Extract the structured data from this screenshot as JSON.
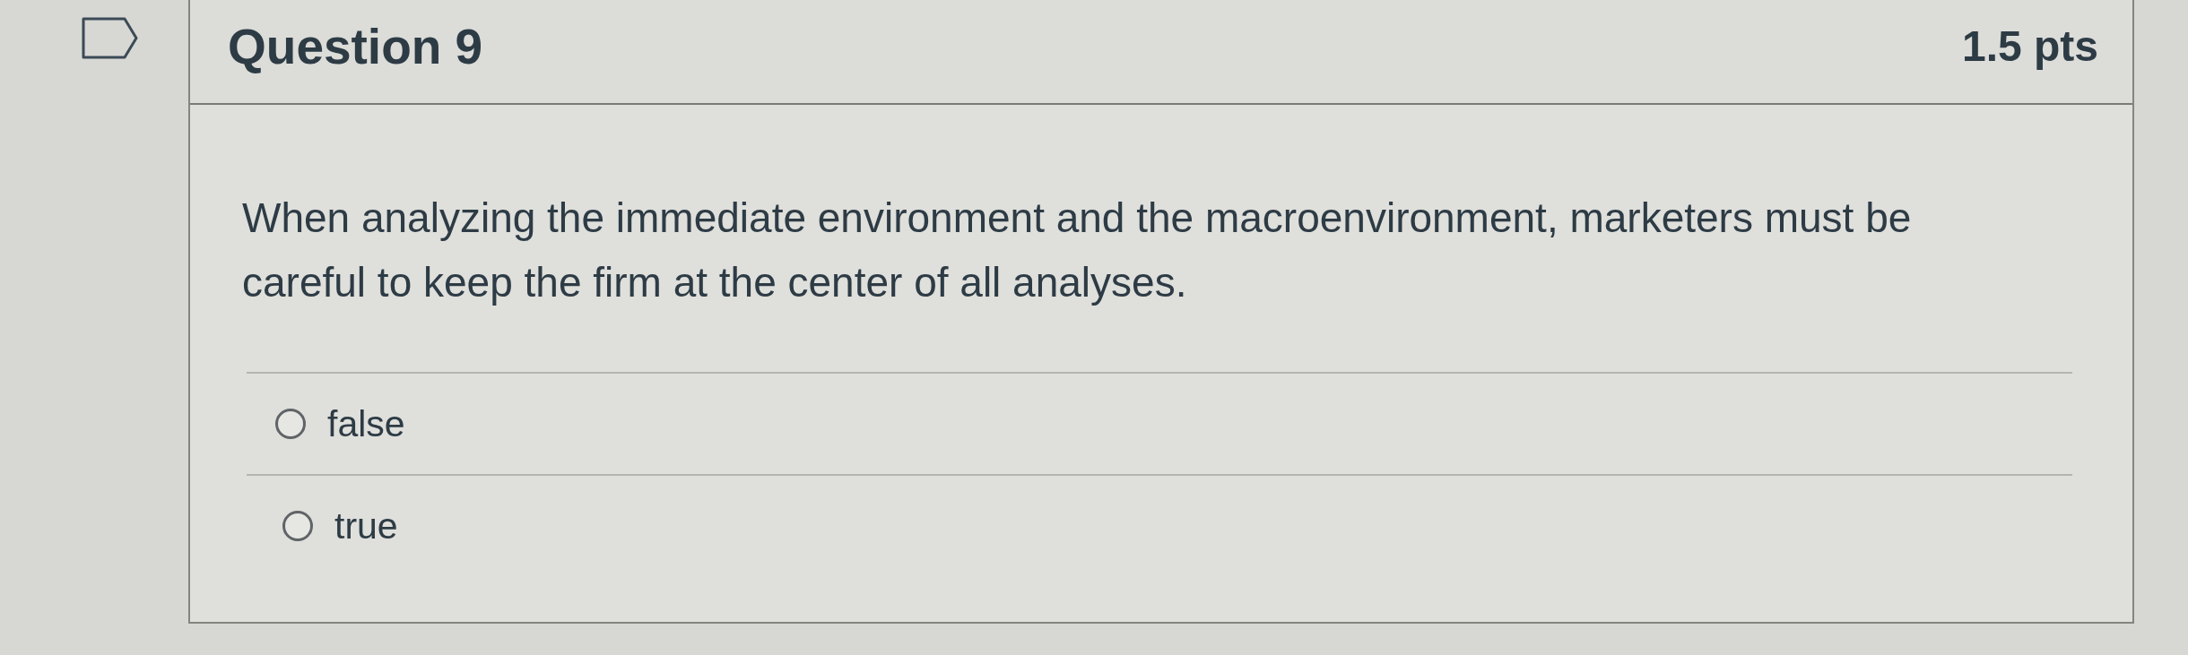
{
  "question": {
    "flagged": false,
    "title": "Question 9",
    "points": "1.5 pts",
    "text": "When analyzing the immediate environment and the macroenvironment, marketers must be careful to keep the firm at the center of all analyses.",
    "options": [
      {
        "label": "false",
        "selected": false
      },
      {
        "label": "true",
        "selected": false
      }
    ]
  }
}
